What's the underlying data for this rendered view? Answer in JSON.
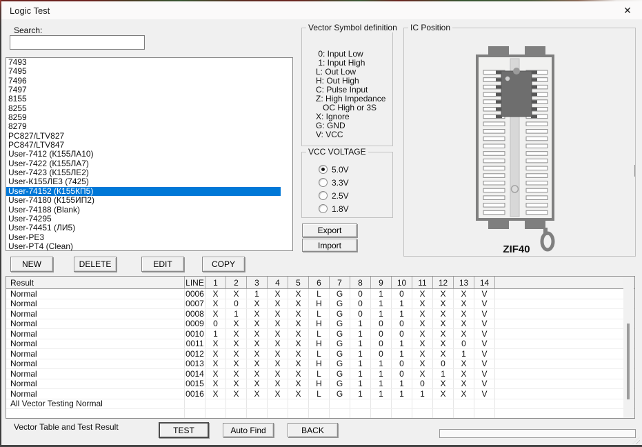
{
  "window": {
    "title": "Logic Test",
    "close_glyph": "✕"
  },
  "search": {
    "label": "Search:",
    "value": "",
    "placeholder": ""
  },
  "device_list": {
    "items": [
      "7493",
      "7495",
      "7496",
      "7497",
      "8155",
      "8255",
      "8259",
      "8279",
      "PC827/LTV827",
      "PC847/LTV847",
      "User-7412 (К155ЛА10)",
      "User-7422 (К155ЛА7)",
      "User-7423 (К155ЛЕ2)",
      "User-К155ЛЕ3 (7425)",
      "User-74152 (К155КП5)",
      "User-74180 (К155ИП2)",
      "User-74188 (Blank)",
      "User-74295",
      "User-74451 (ЛИ5)",
      "User-PE3",
      "User-PT4 (Clean)"
    ],
    "selected_index": 14,
    "selected_item": "User-74152 (К155КП5)"
  },
  "list_actions": {
    "new": "NEW",
    "delete": "DELETE",
    "edit": "EDIT",
    "copy": "COPY"
  },
  "vector_symbols": {
    "title": "Vector Symbol definition",
    "lines": [
      " 0: Input Low",
      " 1: Input High",
      "L: Out Low",
      "H: Out High",
      "C: Pulse Input",
      "Z: High Impedance",
      "   OC High or 3S",
      "X: Ignore",
      "G: GND",
      "V: VCC"
    ]
  },
  "vcc_voltage": {
    "title": "VCC VOLTAGE",
    "options": [
      {
        "label": "5.0V",
        "selected": true
      },
      {
        "label": "3.3V",
        "selected": false
      },
      {
        "label": "2.5V",
        "selected": false
      },
      {
        "label": "1.8V",
        "selected": false
      }
    ]
  },
  "io_buttons": {
    "export": "Export",
    "import": "Import"
  },
  "ic_position": {
    "title": "IC Position",
    "socket_label": "ZIF40"
  },
  "vector_table": {
    "columns": {
      "result": "Result",
      "line": "LINE",
      "pins": [
        "1",
        "2",
        "3",
        "4",
        "5",
        "6",
        "7",
        "8",
        "9",
        "10",
        "11",
        "12",
        "13",
        "14"
      ]
    },
    "rows": [
      {
        "result": "Normal",
        "line": "0006",
        "values": [
          "X",
          "X",
          "1",
          "X",
          "X",
          "L",
          "G",
          "0",
          "1",
          "0",
          "X",
          "X",
          "X",
          "V"
        ]
      },
      {
        "result": "Normal",
        "line": "0007",
        "values": [
          "X",
          "0",
          "X",
          "X",
          "X",
          "H",
          "G",
          "0",
          "1",
          "1",
          "X",
          "X",
          "X",
          "V"
        ]
      },
      {
        "result": "Normal",
        "line": "0008",
        "values": [
          "X",
          "1",
          "X",
          "X",
          "X",
          "L",
          "G",
          "0",
          "1",
          "1",
          "X",
          "X",
          "X",
          "V"
        ]
      },
      {
        "result": "Normal",
        "line": "0009",
        "values": [
          "0",
          "X",
          "X",
          "X",
          "X",
          "H",
          "G",
          "1",
          "0",
          "0",
          "X",
          "X",
          "X",
          "V"
        ]
      },
      {
        "result": "Normal",
        "line": "0010",
        "values": [
          "1",
          "X",
          "X",
          "X",
          "X",
          "L",
          "G",
          "1",
          "0",
          "0",
          "X",
          "X",
          "X",
          "V"
        ]
      },
      {
        "result": "Normal",
        "line": "0011",
        "values": [
          "X",
          "X",
          "X",
          "X",
          "X",
          "H",
          "G",
          "1",
          "0",
          "1",
          "X",
          "X",
          "0",
          "V"
        ]
      },
      {
        "result": "Normal",
        "line": "0012",
        "values": [
          "X",
          "X",
          "X",
          "X",
          "X",
          "L",
          "G",
          "1",
          "0",
          "1",
          "X",
          "X",
          "1",
          "V"
        ]
      },
      {
        "result": "Normal",
        "line": "0013",
        "values": [
          "X",
          "X",
          "X",
          "X",
          "X",
          "H",
          "G",
          "1",
          "1",
          "0",
          "X",
          "0",
          "X",
          "V"
        ]
      },
      {
        "result": "Normal",
        "line": "0014",
        "values": [
          "X",
          "X",
          "X",
          "X",
          "X",
          "L",
          "G",
          "1",
          "1",
          "0",
          "X",
          "1",
          "X",
          "V"
        ]
      },
      {
        "result": "Normal",
        "line": "0015",
        "values": [
          "X",
          "X",
          "X",
          "X",
          "X",
          "H",
          "G",
          "1",
          "1",
          "1",
          "0",
          "X",
          "X",
          "V"
        ]
      },
      {
        "result": "Normal",
        "line": "0016",
        "values": [
          "X",
          "X",
          "X",
          "X",
          "X",
          "L",
          "G",
          "1",
          "1",
          "1",
          "1",
          "X",
          "X",
          "V"
        ]
      }
    ],
    "footer": "All Vector Testing Normal"
  },
  "bottom_bar": {
    "status_label": "Vector Table and Test Result",
    "test": "TEST",
    "auto_find": "Auto Find",
    "back": "BACK"
  },
  "colors": {
    "selection": "#0078d7",
    "dialog_bg": "#f0f0f0",
    "titlebar_bg": "#fbfafa"
  }
}
